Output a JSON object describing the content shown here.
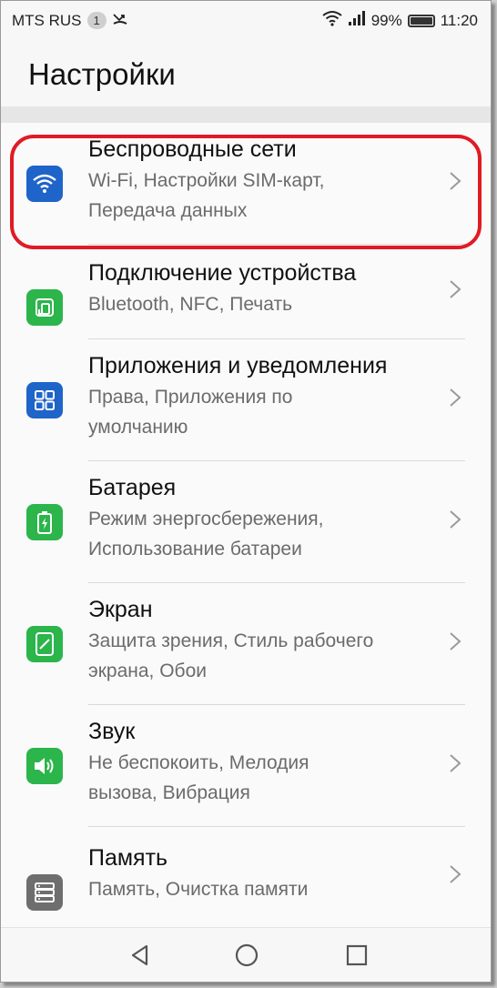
{
  "status_bar": {
    "carrier": "MTS RUS",
    "sim_badge": "1",
    "battery_percent": "99%",
    "battery_level": 0.99,
    "time": "11:20",
    "icons": [
      "missed-call-icon",
      "wifi-icon",
      "signal-icon",
      "battery-icon"
    ]
  },
  "header": {
    "title": "Настройки"
  },
  "settings": [
    {
      "title": "Беспроводные сети",
      "subtitle_lines": [
        "Wi-Fi, Настройки SIM-карт,",
        "Передача данных"
      ],
      "icon": "wifi-icon",
      "color": "#1f64c8"
    },
    {
      "title": "Подключение устройства",
      "subtitle_lines": [
        "Bluetooth, NFC, Печать"
      ],
      "icon": "device-connection-icon",
      "color": "#2bb54b"
    },
    {
      "title": "Приложения и уведомления",
      "subtitle_lines": [
        "Права, Приложения по",
        "умолчанию"
      ],
      "icon": "apps-grid-icon",
      "color": "#1f64c8"
    },
    {
      "title": "Батарея",
      "subtitle_lines": [
        "Режим энергосбережения,",
        "Использование батареи"
      ],
      "icon": "battery-icon",
      "color": "#2bb54b"
    },
    {
      "title": "Экран",
      "subtitle_lines": [
        "Защита зрения, Стиль рабочего",
        "экрана, Обои"
      ],
      "icon": "display-icon",
      "color": "#2bb54b"
    },
    {
      "title": "Звук",
      "subtitle_lines": [
        "Не беспокоить, Мелодия",
        "вызова, Вибрация"
      ],
      "icon": "speaker-icon",
      "color": "#2bb54b"
    },
    {
      "title": "Память",
      "subtitle_lines": [
        "Память, Очистка памяти"
      ],
      "icon": "storage-icon",
      "color": "#6e6e6e"
    }
  ],
  "highlighted_item": "Беспроводные сети",
  "highlight_color": "#e01b24",
  "nav_bar": {
    "icons": [
      "back-icon",
      "home-icon",
      "recents-icon"
    ]
  }
}
